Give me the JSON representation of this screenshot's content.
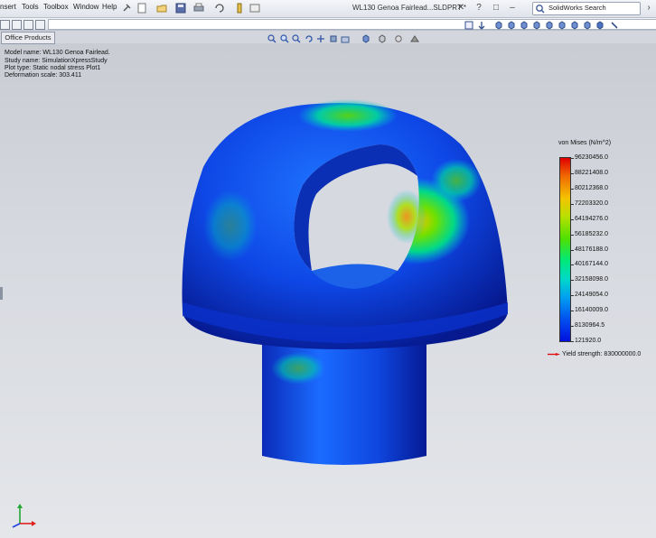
{
  "menubar": {
    "items": [
      "nsert",
      "Tools",
      "Toolbox",
      "Window",
      "Help"
    ],
    "document_title": "WL130 Genoa Fairlead...SLDPRT *",
    "search_placeholder": "SolidWorks Search"
  },
  "tabs": {
    "office_products": "Office Products"
  },
  "study_info": {
    "model_name": "Model name: WL130 Genoa Fairlead.",
    "study_name": "Study name: SimulationXpressStudy",
    "plot_type": "Plot type: Static nodal stress Plot1",
    "deformation_scale": "Deformation scale: 303.411"
  },
  "legend": {
    "title": "von Mises (N/m^2)",
    "values": [
      "96230456.0",
      "88221408.0",
      "80212368.0",
      "72203320.0",
      "64194276.0",
      "56185232.0",
      "48176188.0",
      "40167144.0",
      "32158098.0",
      "24149054.0",
      "16140009.0",
      "8130964.5",
      "121920.0"
    ],
    "yield_strength": "Yield strength: 830000000.0",
    "yield_color": "#e01010"
  },
  "colors": {
    "high_stress": "#e00000",
    "mid_stress": "#4fe000",
    "low_stress": "#0010e0"
  }
}
